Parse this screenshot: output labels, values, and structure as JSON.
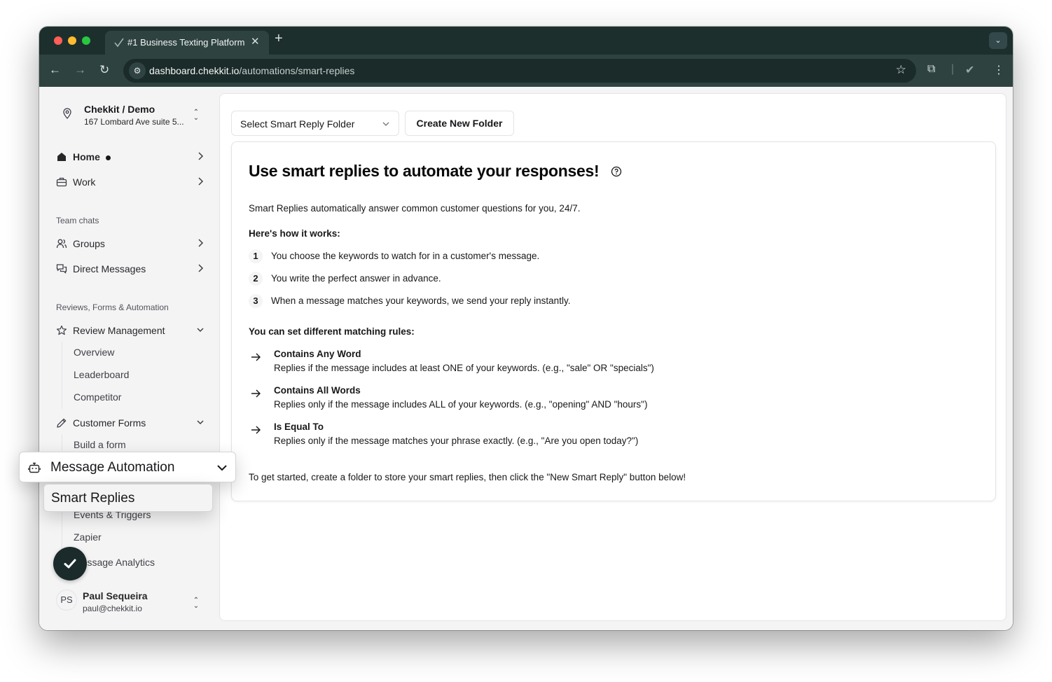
{
  "browser": {
    "tab_title": "#1 Business Texting Platform",
    "url_host": "dashboard.chekkit.io",
    "url_path": "/automations/smart-replies"
  },
  "sidebar": {
    "location_name": "Chekkit / Demo",
    "location_address": "167 Lombard Ave suite 5...",
    "home_label": "Home",
    "work_label": "Work",
    "team_chats_label": "Team chats",
    "groups_label": "Groups",
    "direct_messages_label": "Direct Messages",
    "reviews_section_label": "Reviews, Forms & Automation",
    "review_management_label": "Review Management",
    "review_sub": [
      "Overview",
      "Leaderboard",
      "Competitor"
    ],
    "customer_forms_label": "Customer Forms",
    "build_form_label": "Build a form",
    "message_automation_label": "Message Automation",
    "smart_replies_label": "Smart Replies",
    "events_triggers_label": "Events & Triggers",
    "zapier_label": "Zapier",
    "message_analytics_label": "Message Analytics",
    "user_initials": "PS",
    "user_name": "Paul Sequeira",
    "user_email": "paul@chekkit.io"
  },
  "main": {
    "folder_select_label": "Select Smart Reply Folder",
    "create_folder_label": "Create New Folder",
    "title": "Use smart replies to automate your responses!",
    "intro": "Smart Replies automatically answer common customer questions for you, 24/7.",
    "how_heading": "Here's how it works:",
    "steps": [
      {
        "num": "1",
        "text": "You choose the keywords to watch for in a customer's message."
      },
      {
        "num": "2",
        "text": "You write the perfect answer in advance."
      },
      {
        "num": "3",
        "text": "When a message matches your keywords, we send your reply instantly."
      }
    ],
    "rules_heading": "You can set different matching rules:",
    "rules": [
      {
        "name": "Contains Any Word",
        "desc": "Replies if the message includes at least ONE of your keywords. (e.g., \"sale\" OR \"specials\")"
      },
      {
        "name": "Contains All Words",
        "desc": "Replies only if the message includes ALL of your keywords. (e.g., \"opening\" AND \"hours\")"
      },
      {
        "name": "Is Equal To",
        "desc": "Replies only if the message matches your phrase exactly. (e.g., \"Are you open today?\")"
      }
    ],
    "outro": "To get started, create a folder to store your smart replies, then click the \"New Smart Reply\" button below!"
  },
  "icons": {
    "location": "map-pin-icon",
    "home": "home-icon",
    "work": "briefcase-icon",
    "groups": "users-icon",
    "dm": "messages-icon",
    "review": "star-icon",
    "forms": "pencil-icon",
    "automation": "bot-icon",
    "help": "help-circle-icon",
    "arrow": "arrow-right-icon",
    "fab": "check-icon"
  },
  "colors": {
    "browser_frame": "#1d2f2d",
    "browser_toolbar": "#2e4340",
    "app_background": "#f4f4f5",
    "fab_background": "#1b2b2b"
  }
}
